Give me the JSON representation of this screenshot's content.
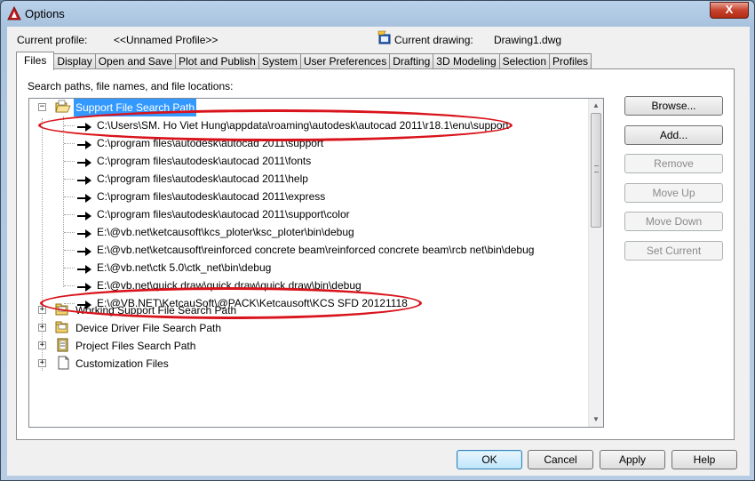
{
  "window": {
    "title": "Options",
    "close_label": "X"
  },
  "profile": {
    "current_profile_label": "Current profile:",
    "current_profile_value": "<<Unnamed Profile>>",
    "current_drawing_label": "Current drawing:",
    "current_drawing_value": "Drawing1.dwg"
  },
  "tabs": [
    "Files",
    "Display",
    "Open and Save",
    "Plot and Publish",
    "System",
    "User Preferences",
    "Drafting",
    "3D Modeling",
    "Selection",
    "Profiles"
  ],
  "active_tab": "Files",
  "panel": {
    "label": "Search paths, file names, and file locations:"
  },
  "tree": {
    "root": {
      "label": "Support File Search Path",
      "expanded": true
    },
    "children": [
      "C:\\Users\\SM. Ho Viet Hung\\appdata\\roaming\\autodesk\\autocad 2011\\r18.1\\enu\\support",
      "C:\\program files\\autodesk\\autocad 2011\\support",
      "C:\\program files\\autodesk\\autocad 2011\\fonts",
      "C:\\program files\\autodesk\\autocad 2011\\help",
      "C:\\program files\\autodesk\\autocad 2011\\express",
      "C:\\program files\\autodesk\\autocad 2011\\support\\color",
      "E:\\@vb.net\\ketcausoft\\kcs_ploter\\ksc_ploter\\bin\\debug",
      "E:\\@vb.net\\ketcausoft\\reinforced concrete beam\\reinforced concrete beam\\rcb net\\bin\\debug",
      "E:\\@vb.net\\ctk 5.0\\ctk_net\\bin\\debug",
      "E:\\@vb.net\\quick draw\\quick draw\\quick draw\\bin\\debug",
      "E:\\@VB.NET\\KetcauSoft\\@PACK\\Ketcausoft\\KCS SFD 20121118"
    ],
    "siblings": [
      {
        "label": "Working Support File Search Path",
        "icon": "folder-icon"
      },
      {
        "label": "Device Driver File Search Path",
        "icon": "folder-icon"
      },
      {
        "label": "Project Files Search Path",
        "icon": "project-icon"
      },
      {
        "label": "Customization Files",
        "icon": "file-icon"
      }
    ]
  },
  "side_buttons": [
    {
      "label": "Browse...",
      "enabled": true
    },
    {
      "label": "Add...",
      "enabled": true
    },
    {
      "label": "Remove",
      "enabled": false
    },
    {
      "label": "Move Up",
      "enabled": false
    },
    {
      "label": "Move Down",
      "enabled": false
    },
    {
      "label": "Set Current",
      "enabled": false
    }
  ],
  "bottom_buttons": {
    "ok": "OK",
    "cancel": "Cancel",
    "apply": "Apply",
    "help": "Help"
  },
  "colors": {
    "selection": "#3399ff",
    "annotation": "#d9131b",
    "title_gradient": "#b9d1ea"
  }
}
